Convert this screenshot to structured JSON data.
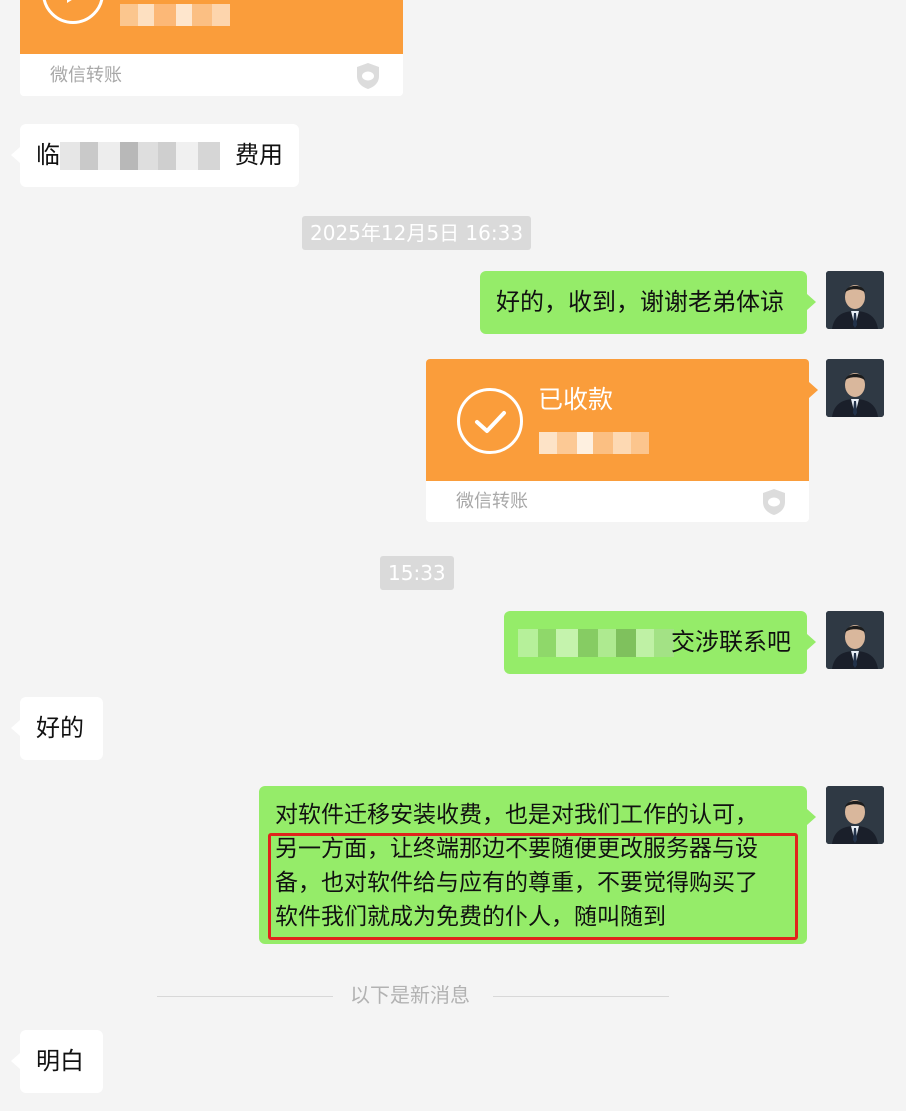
{
  "chat": {
    "transfer_top": {
      "footer": "微信转账"
    },
    "msg_left_fee": {
      "text_start": "临",
      "text_end": "费用"
    },
    "time_1": "2025年12月5日 16:33",
    "msg_right_1": "好的，收到，谢谢老弟体谅",
    "transfer_received": {
      "title": "已收款",
      "footer": "微信转账"
    },
    "time_2": "15:33",
    "msg_right_2_end": "交涉联系吧",
    "msg_left_ok": "好的",
    "msg_right_long": {
      "line1": "对软件迁移安装收费，也是对我们工作的认可，",
      "line2": "另一方面，让终端那边不要随便更改服务器与设",
      "line3": "备，也对软件给与应有的尊重，不要觉得购买了",
      "line4": "软件我们就成为免费的仆人，随叫随到"
    },
    "new_messages_label": "以下是新消息",
    "msg_left_last": "明白"
  },
  "colors": {
    "background": "#f4f4f4",
    "green_bubble": "#95ec69",
    "white_bubble": "#ffffff",
    "transfer_orange": "#fa9d3b",
    "highlight_red": "#e0241c"
  },
  "icons": {
    "play": "play-circle-icon",
    "check": "check-circle-icon",
    "shield": "wechat-pay-shield-icon"
  }
}
